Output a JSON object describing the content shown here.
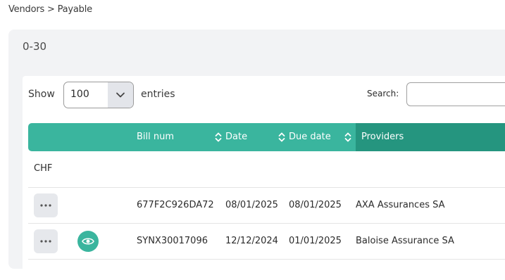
{
  "breadcrumb": "Vendors > Payable",
  "panel": {
    "title": "0-30"
  },
  "controls": {
    "show_label": "Show",
    "entries_value": "100",
    "entries_label": "entries",
    "search_label": "Search:",
    "search_value": ""
  },
  "table": {
    "columns": [
      "Bill num",
      "Date",
      "Due date",
      "Providers"
    ],
    "group_label": "CHF",
    "rows": [
      {
        "bill_num": "677F2C926DA72",
        "date": "08/01/2025",
        "due_date": "08/01/2025",
        "provider": "AXA Assurances SA",
        "has_view": false
      },
      {
        "bill_num": "SYNX30017096",
        "date": "12/12/2024",
        "due_date": "01/01/2025",
        "provider": "Baloise Assurance SA",
        "has_view": true
      }
    ]
  },
  "colors": {
    "header": "#3ab59e",
    "header_active": "#25957f",
    "accent": "#3ab59e"
  },
  "icons": {
    "sort": "sort-up-down-icon",
    "actions": "more-dots-icon",
    "view": "eye-icon",
    "dropdown": "chevron-down-icon"
  }
}
